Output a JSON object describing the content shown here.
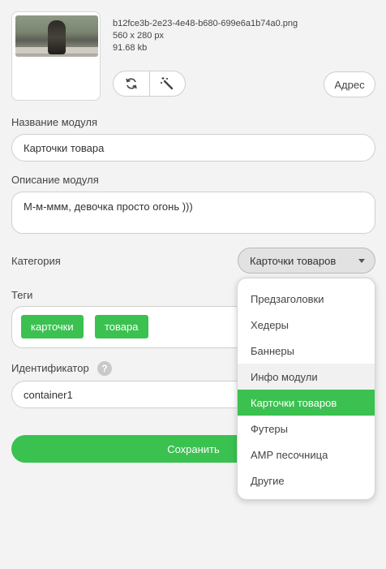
{
  "image": {
    "filename": "b12fce3b-2e23-4e48-b680-699e6a1b74a0.png",
    "dimensions": "560 x 280 px",
    "size": "91.68 kb",
    "address_button": "Адрес",
    "icons": [
      "refresh-icon",
      "magic-wand-icon"
    ]
  },
  "module_name": {
    "label": "Название модуля",
    "value": "Карточки товара"
  },
  "module_description": {
    "label": "Описание модуля",
    "value": "М-м-ммм, девочка просто огонь )))"
  },
  "category": {
    "label": "Категория",
    "selected": "Карточки товаров",
    "options": [
      "Предзаголовки",
      "Хедеры",
      "Баннеры",
      "Инфо модули",
      "Карточки товаров",
      "Футеры",
      "AMP песочница",
      "Другие"
    ],
    "hovered_option": "Инфо модули"
  },
  "tags": {
    "label": "Теги",
    "items": [
      "карточки",
      "товара"
    ]
  },
  "identifier": {
    "label": "Идентификатор",
    "help": "?",
    "value": "container1"
  },
  "save_button": "Сохранить",
  "colors": {
    "accent": "#3bc150",
    "background": "#f3f3f3"
  }
}
